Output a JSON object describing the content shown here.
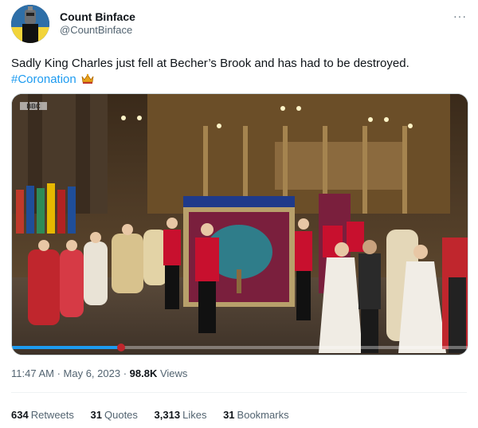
{
  "account": {
    "display_name": "Count Binface",
    "handle": "@CountBinface",
    "avatar_icon": "avatar-icon"
  },
  "more_label": "···",
  "tweet": {
    "text": "Sadly King Charles just fell at Becher’s Brook and has had to be destroyed.",
    "hashtag": "#Coronation",
    "emoji_icon": "crown-icon"
  },
  "media": {
    "watermark": "BBC",
    "description_icon": "coronation-video-frame"
  },
  "meta": {
    "time": "11:47 AM",
    "separator": " · ",
    "date": "May 6, 2023",
    "views_count": "98.8K",
    "views_label": " Views"
  },
  "stats": [
    {
      "count": "634",
      "label": "Retweets"
    },
    {
      "count": "31",
      "label": "Quotes"
    },
    {
      "count": "3,313",
      "label": "Likes"
    },
    {
      "count": "31",
      "label": "Bookmarks"
    }
  ],
  "colors": {
    "link": "#1d9bf0",
    "secondary_text": "#536471",
    "primary_text": "#0f1419"
  }
}
